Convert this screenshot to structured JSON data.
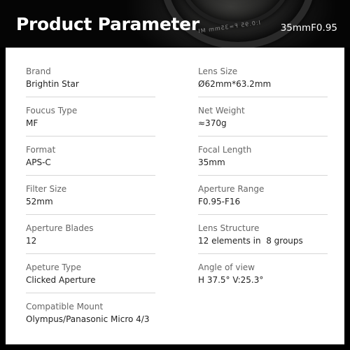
{
  "header": {
    "title": "Product Parameter",
    "model": "35mmF0.95",
    "lens_engraving": "I:0.95 F=35mm MI"
  },
  "params": {
    "left": [
      {
        "label": "Brand",
        "value": "Brightin Star"
      },
      {
        "label": "Foucus Type",
        "value": "MF"
      },
      {
        "label": "Format",
        "value": "APS-C"
      },
      {
        "label": "Filter Size",
        "value": "52mm"
      },
      {
        "label": "Aperture Blades",
        "value": "12"
      },
      {
        "label": "Apeture Type",
        "value": "Clicked Aperture"
      },
      {
        "label": "Compatible Mount",
        "value": "Olympus/Panasonic Micro 4/3"
      }
    ],
    "right": [
      {
        "label": "Lens Size",
        "value": "Ø62mm*63.2mm"
      },
      {
        "label": "Net Weight",
        "value": "≈370g"
      },
      {
        "label": "Focal Length",
        "value": "35mm"
      },
      {
        "label": "Aperture Range",
        "value": "F0.95-F16"
      },
      {
        "label": "Lens Structure",
        "value": "12 elements in  8 groups"
      },
      {
        "label": "Angle of view",
        "value": "H 37.5° V:25.3°"
      }
    ]
  }
}
